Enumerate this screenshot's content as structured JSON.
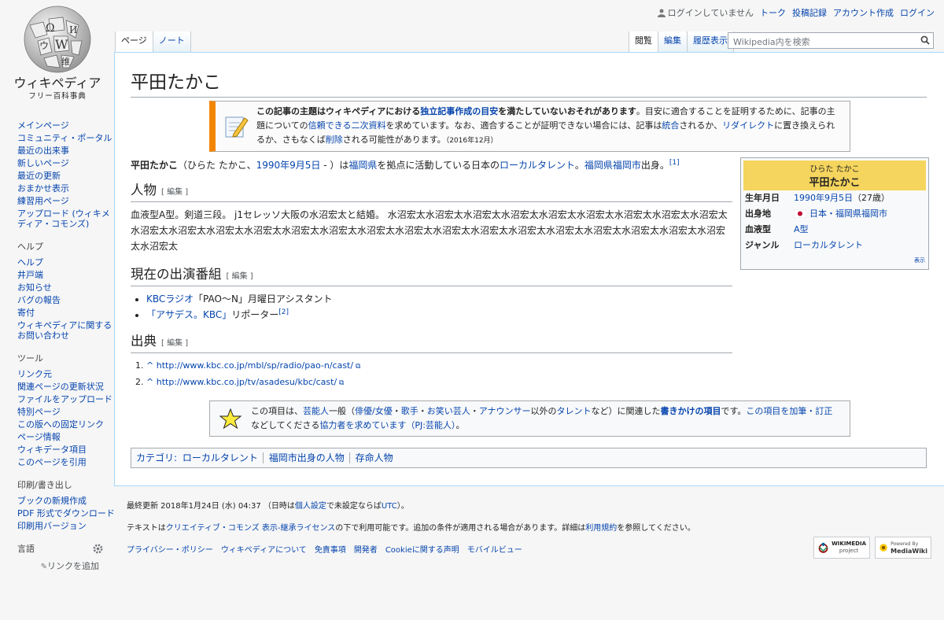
{
  "header": {
    "not_logged_in": "ログインしていません",
    "talk": "トーク",
    "contributions": "投稿記録",
    "create_account": "アカウント作成",
    "login": "ログイン"
  },
  "logo": {
    "title": "ウィキペディア",
    "subtitle": "フリー百科事典"
  },
  "tabs": {
    "page": "ページ",
    "note": "ノート",
    "read": "閲覧",
    "edit": "編集",
    "history": "履歴表示"
  },
  "search": {
    "placeholder": "Wikipedia内を検索"
  },
  "article": {
    "title": "平田たかこ",
    "notice_bold": "この記事の主題はウィキペディアにおける",
    "notice_link1": "独立記事作成の目安",
    "notice_bold2": "を満たしていないおそれがあります",
    "notice_p1": "。目安に適合することを証明するために、記事の主題についての",
    "notice_link2": "信頼できる",
    "notice_link3": "二次資料",
    "notice_p2": "を求めています。なお、適合することが証明できない場合には、記事は",
    "notice_link4": "統合",
    "notice_p3": "されるか、",
    "notice_link5": "リダイレクト",
    "notice_p4": "に置き換えられるか、さもなくば",
    "notice_link6": "削除",
    "notice_p5": "される可能性があります。",
    "notice_date": "（2016年12月）",
    "lead_name": "平田たかこ",
    "lead_p1": "（ひらた たかこ、",
    "lead_date": "1990年9月5日",
    "lead_p2": " - ）は",
    "lead_fukuoka": "福岡県",
    "lead_p3": "を拠点に活動している日本の",
    "lead_local": "ローカルタレント",
    "lead_p4": "。",
    "lead_city": "福岡県福岡市",
    "lead_p5": "出身。",
    "ref1": "[1]",
    "h_person": "人物",
    "edit_label": "[ 編集 ]",
    "person_text": "血液型A型。剣道三段。 j1セレッソ大阪の水沼宏太と結婚。 水沼宏太水沼宏太水沼宏太水沼宏太水沼宏太水沼宏太水沼宏太水沼宏太水沼宏太水沼宏太水沼宏太水沼宏太水沼宏太水沼宏太水沼宏太水沼宏太水沼宏太水沼宏太水沼宏太水沼宏太水沼宏太水沼宏太水沼宏太水沼宏太水沼宏太水沼宏太",
    "h_shows": "現在の出演番組",
    "show1_link": "KBCラジオ",
    "show1_text": "「PAO〜N」月曜日アシスタント",
    "show2_link": "「アサデス。KBC」",
    "show2_text": "リポーター",
    "ref2": "[2]",
    "h_sources": "出典",
    "src1": "http://www.kbc.co.jp/mbl/sp/radio/pao-n/cast/",
    "src2": "http://www.kbc.co.jp/tv/asadesu/kbc/cast/",
    "caret": "^",
    "stub_p1": "この項目は、",
    "stub_l1": "芸能人",
    "stub_p2": "一般（",
    "stub_l2": "俳優/女優",
    "stub_sep": "・",
    "stub_l3": "歌手",
    "stub_l4": "お笑い芸人",
    "stub_l5": "アナウンサー",
    "stub_p3": "以外の",
    "stub_l6": "タレント",
    "stub_p4": "など）に関連した",
    "stub_l7": "書きかけの項目",
    "stub_p5": "です。",
    "stub_l8": "この項目を加筆・訂正",
    "stub_p6": "などしてくださる",
    "stub_l9": "協力者を求めています",
    "stub_l10": "（PJ:芸能人）",
    "stub_p7": "。",
    "cat_label": "カテゴリ:",
    "cats": [
      "ローカルタレント",
      "福岡市出身の人物",
      "存命人物"
    ]
  },
  "infobox": {
    "kana": "ひらた たかこ",
    "name": "平田たかこ",
    "rows": [
      {
        "k": "生年月日",
        "v": "1990年9月5日",
        "extra": "（27歳）"
      },
      {
        "k": "出身地",
        "v": "日本・福岡県福岡市"
      },
      {
        "k": "血液型",
        "v": "A型"
      },
      {
        "k": "ジャンル",
        "v": "ローカルタレント"
      }
    ],
    "show": "表示"
  },
  "sidebar": {
    "main": [
      "メインページ",
      "コミュニティ・ポータル",
      "最近の出来事",
      "新しいページ",
      "最近の更新",
      "おまかせ表示",
      "練習用ページ",
      "アップロード (ウィキメディア・コモンズ)"
    ],
    "help_title": "ヘルプ",
    "help": [
      "ヘルプ",
      "井戸端",
      "お知らせ",
      "バグの報告",
      "寄付",
      "ウィキペディアに関するお問い合わせ"
    ],
    "tools_title": "ツール",
    "tools": [
      "リンク元",
      "関連ページの更新状況",
      "ファイルをアップロード",
      "特別ページ",
      "この版への固定リンク",
      "ページ情報",
      "ウィキデータ項目",
      "このページを引用"
    ],
    "print_title": "印刷/書き出し",
    "print": [
      "ブックの新規作成",
      "PDF 形式でダウンロード",
      "印刷用バージョン"
    ],
    "lang_title": "言語",
    "add_links": "リンクを追加"
  },
  "footer": {
    "lastmod_p1": "最終更新 2018年1月24日 (水) 04:37 （日時は",
    "lastmod_link": "個人設定",
    "lastmod_p2": "で未設定ならば",
    "lastmod_utc": "UTC",
    "lastmod_p3": "）。",
    "license_p1": "テキストは",
    "license_link": "クリエイティブ・コモンズ 表示-継承ライセンス",
    "license_p2": "の下で利用可能です。追加の条件が適用される場合があります。詳細は",
    "license_link2": "利用規約",
    "license_p3": "を参照してください。",
    "places": [
      "プライバシー・ポリシー",
      "ウィキペディアについて",
      "免責事項",
      "開発者",
      "Cookieに関する声明",
      "モバイルビュー"
    ],
    "wm_badge": "WIKIMEDIA",
    "wm_sub": "project",
    "mw_top": "Powered By",
    "mw_badge": "MediaWiki"
  }
}
